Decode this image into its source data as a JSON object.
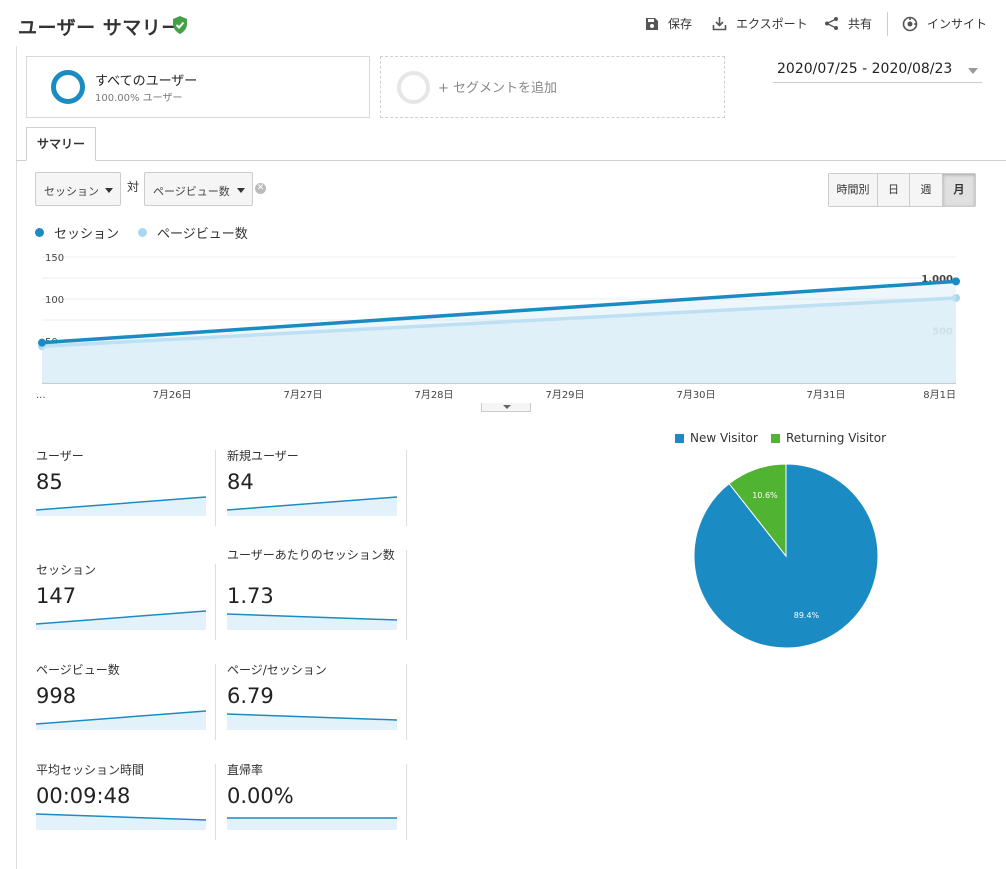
{
  "header": {
    "title": "ユーザー サマリー",
    "actions": [
      {
        "label": "保存",
        "icon": "save-icon"
      },
      {
        "label": "エクスポート",
        "icon": "export-icon"
      },
      {
        "label": "共有",
        "icon": "share-icon"
      },
      {
        "label": "インサイト",
        "icon": "insights-icon"
      }
    ]
  },
  "segments": {
    "active": {
      "name": "すべてのユーザー",
      "sub": "100.00% ユーザー"
    },
    "add_label": "+ セグメントを追加"
  },
  "date_range": "2020/07/25 - 2020/08/23",
  "tab": "サマリー",
  "controls": {
    "metric1": "セッション",
    "vs": "対",
    "metric2": "ページビュー数",
    "granularity": [
      "時間別",
      "日",
      "週",
      "月"
    ],
    "granularity_selected": "月"
  },
  "chart_data": {
    "type": "line",
    "x": [
      "...",
      "7月26日",
      "7月27日",
      "7月28日",
      "7月29日",
      "7月30日",
      "7月31日",
      "8月1日"
    ],
    "series": [
      {
        "name": "セッション",
        "color": "#1a8bc3",
        "axis": "left",
        "start": 48,
        "end": 121
      },
      {
        "name": "ページビュー数",
        "color": "#a8d8f0",
        "axis": "right",
        "start": 350,
        "end": 810
      }
    ],
    "left_axis": {
      "ticks": [
        "150",
        "100",
        "50"
      ],
      "range": [
        0,
        150
      ]
    },
    "right_axis": {
      "ticks": [
        "1,000",
        "500"
      ],
      "range": [
        0,
        1200
      ]
    }
  },
  "scorecards": [
    {
      "label": "ユーザー",
      "value": "85",
      "trend": "up"
    },
    {
      "label": "新規ユーザー",
      "value": "84",
      "trend": "up"
    },
    {
      "label": "セッション",
      "value": "147",
      "trend": "up"
    },
    {
      "label": "ユーザーあたりのセッション数",
      "value": "1.73",
      "trend": "down"
    },
    {
      "label": "ページビュー数",
      "value": "998",
      "trend": "up"
    },
    {
      "label": "ページ/セッション",
      "value": "6.79",
      "trend": "down"
    },
    {
      "label": "平均セッション時間",
      "value": "00:09:48",
      "trend": "down"
    },
    {
      "label": "直帰率",
      "value": "0.00%",
      "trend": "flat"
    }
  ],
  "pie": {
    "slices": [
      {
        "name": "New Visitor",
        "value": 89.4,
        "label": "89.4%",
        "color": "#1a8bc3"
      },
      {
        "name": "Returning Visitor",
        "value": 10.6,
        "label": "10.6%",
        "color": "#50b432"
      }
    ]
  },
  "colors": {
    "accent": "#1a8bc3",
    "light_series": "#a8d8f0",
    "green": "#50b432"
  }
}
